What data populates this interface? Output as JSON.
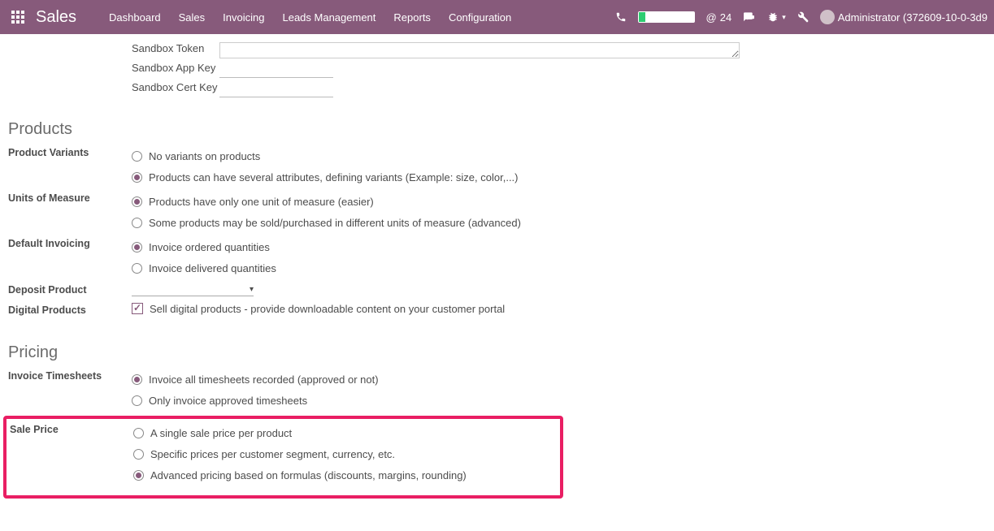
{
  "topbar": {
    "brand": "Sales",
    "menu": [
      "Dashboard",
      "Sales",
      "Invoicing",
      "Leads Management",
      "Reports",
      "Configuration"
    ],
    "msg_count": "24",
    "user_label": "Administrator (372609-10-0-3d9"
  },
  "sandbox": {
    "token_label": "Sandbox Token",
    "appkey_label": "Sandbox App Key",
    "certkey_label": "Sandbox Cert Key"
  },
  "sections": {
    "products": "Products",
    "pricing": "Pricing"
  },
  "labels": {
    "product_variants": "Product Variants",
    "units_of_measure": "Units of Measure",
    "default_invoicing": "Default Invoicing",
    "deposit_product": "Deposit Product",
    "digital_products": "Digital Products",
    "invoice_timesheets": "Invoice Timesheets",
    "sale_price": "Sale Price"
  },
  "opts": {
    "variants": {
      "none": "No variants on products",
      "multi": "Products can have several attributes, defining variants (Example: size, color,...)"
    },
    "uom": {
      "single": "Products have only one unit of measure (easier)",
      "multi": "Some products may be sold/purchased in different units of measure (advanced)"
    },
    "invoicing": {
      "ordered": "Invoice ordered quantities",
      "delivered": "Invoice delivered quantities"
    },
    "digital": "Sell digital products - provide downloadable content on your customer portal",
    "timesheets": {
      "all": "Invoice all timesheets recorded (approved or not)",
      "approved": "Only invoice approved timesheets"
    },
    "saleprice": {
      "single": "A single sale price per product",
      "segment": "Specific prices per customer segment, currency, etc.",
      "advanced": "Advanced pricing based on formulas (discounts, margins, rounding)"
    }
  }
}
